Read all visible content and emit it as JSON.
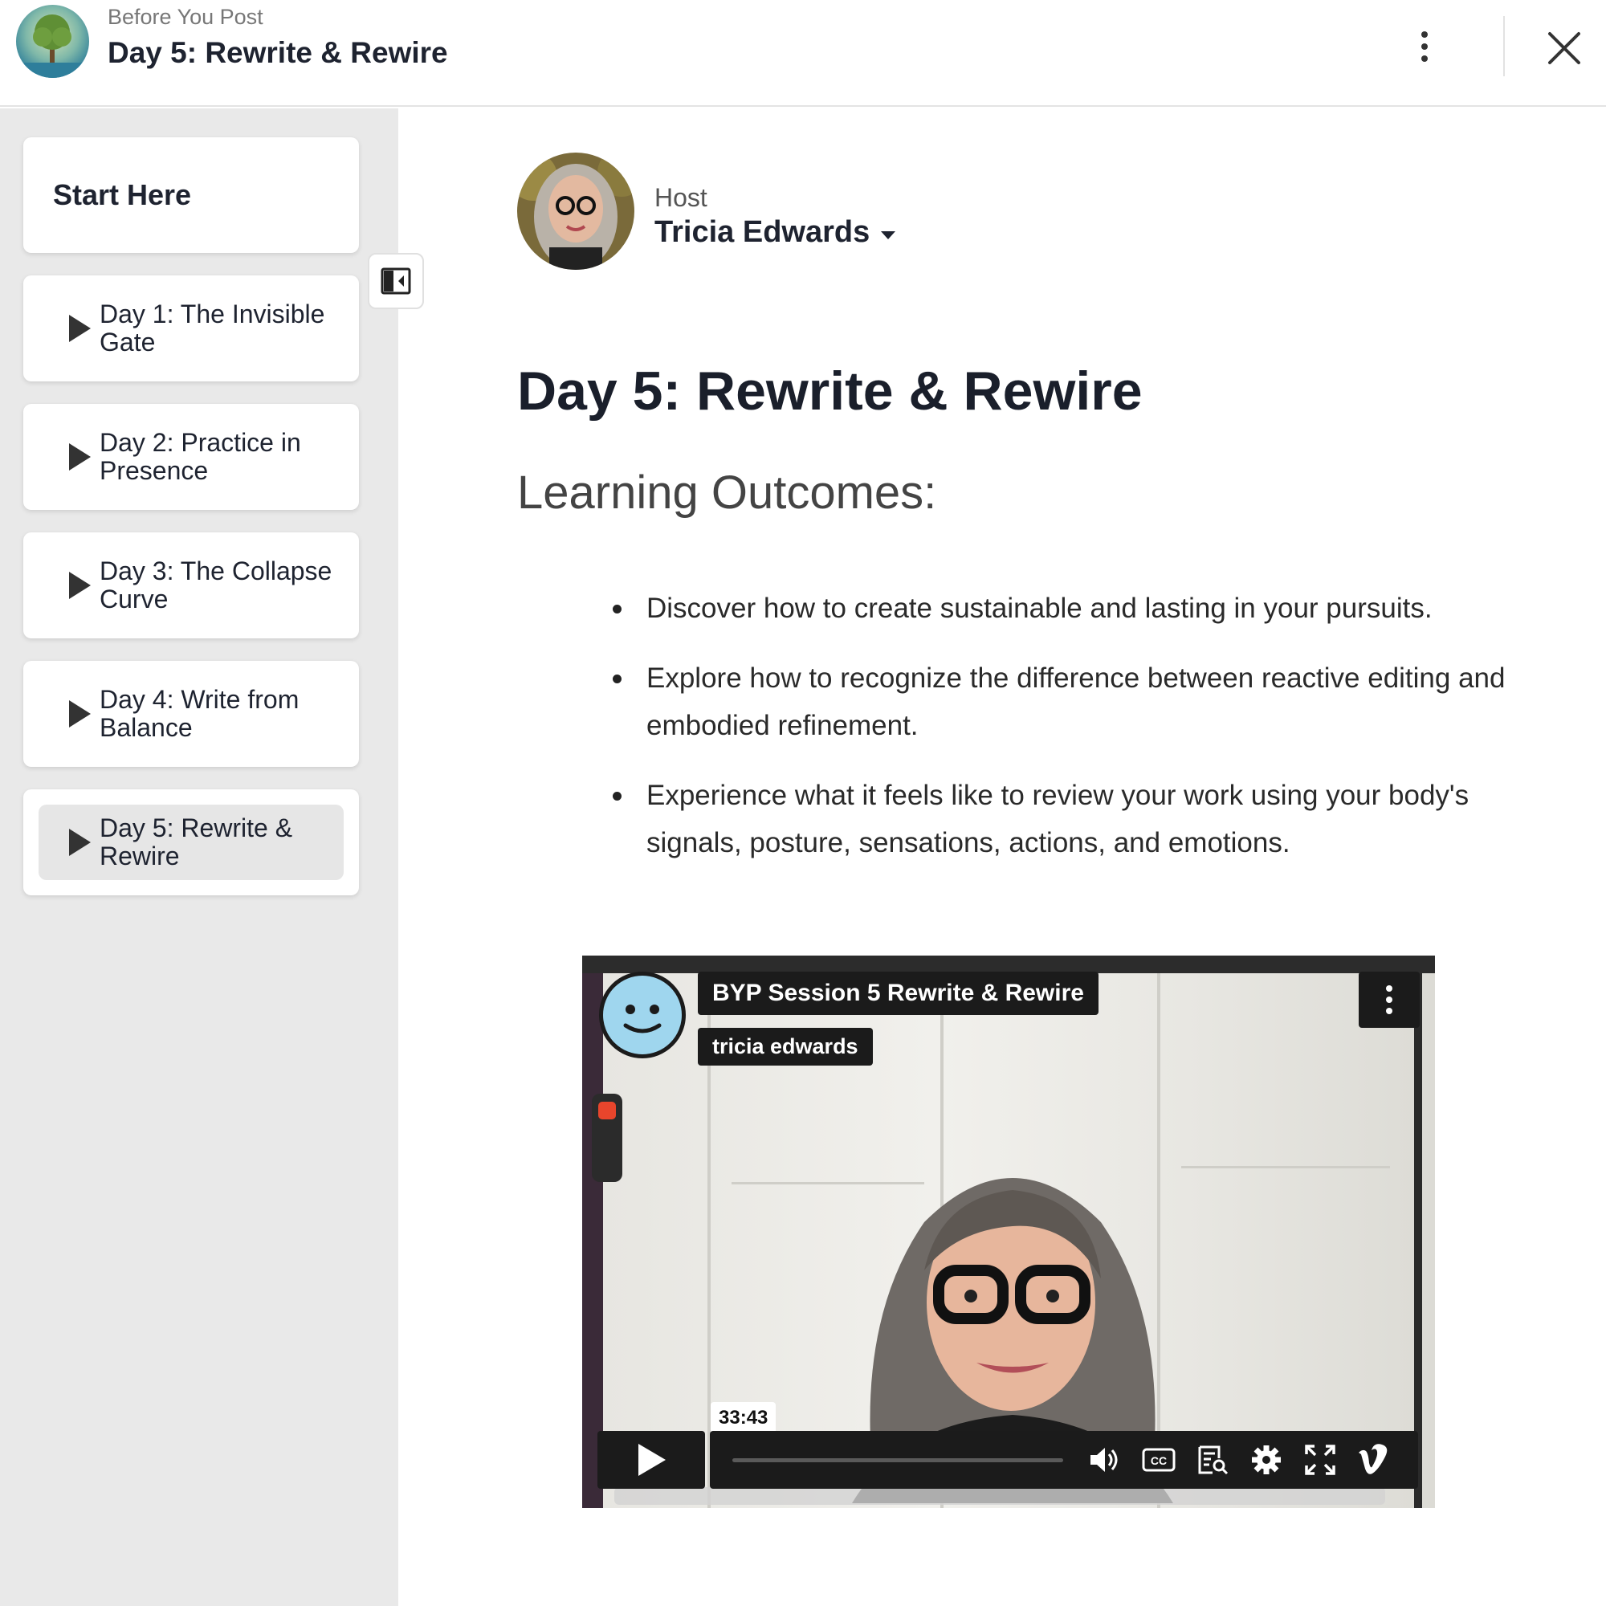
{
  "header": {
    "course_name": "Before You Post",
    "lesson_title": "Day 5: Rewrite & Rewire"
  },
  "sidebar": {
    "start_label": "Start Here",
    "items": [
      {
        "label": "Day 1: The Invisible Gate",
        "active": false
      },
      {
        "label": "Day 2: Practice in Presence",
        "active": false
      },
      {
        "label": "Day 3: The Collapse Curve",
        "active": false
      },
      {
        "label": "Day 4: Write from Balance",
        "active": false
      },
      {
        "label": "Day 5: Rewrite & Rewire",
        "active": true
      }
    ]
  },
  "host": {
    "label": "Host",
    "name": "Tricia Edwards"
  },
  "main": {
    "title": "Day 5: Rewrite & Rewire",
    "section_heading": "Learning Outcomes:",
    "outcomes": [
      "Discover how to create sustainable and lasting in your pursuits.",
      "Explore how to recognize the difference between reactive editing and embodied refinement.",
      "Experience what it feels like to review your work using your body's signals, posture, sensations, actions, and emotions."
    ]
  },
  "video": {
    "title": "BYP Session 5 Rewrite & Rewire",
    "author": "tricia edwards",
    "duration": "33:43",
    "progress_fraction": 0.0
  },
  "icons": {
    "more": "more-vertical-icon",
    "close": "close-icon",
    "collapse": "sidebar-collapse-icon",
    "play": "play-icon",
    "volume": "volume-icon",
    "captions": "captions-icon",
    "transcript": "transcript-icon",
    "settings": "gear-icon",
    "fullscreen": "fullscreen-icon",
    "brand": "vimeo-icon"
  },
  "colors": {
    "sidebar_bg": "#e9e9e9",
    "active_item_bg": "#e6e6e6",
    "text_primary": "#1e2330",
    "player_chrome": "#1b1b1b"
  }
}
